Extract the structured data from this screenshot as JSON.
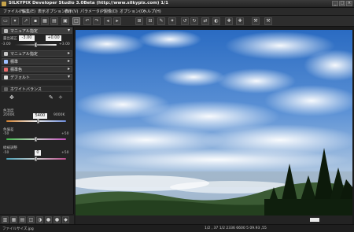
{
  "window": {
    "title": "SILKYPIX Developer Studio 3.0Beta (http://www.silkypix.com)   1/1",
    "controls": [
      "_",
      "□",
      "×"
    ]
  },
  "menu": [
    "ファイル(F)",
    "編集(E)",
    "表示オプション(V)",
    "表示(V)",
    "パラメータ(P)",
    "現像(D)",
    "オプション(O)",
    "ヘルプ(H)"
  ],
  "left_panel": {
    "exposure": {
      "label": "露出補正",
      "value": "-3.00",
      "value2": "+0.00",
      "min": "-3.00",
      "max": "+3.00"
    },
    "rows": [
      {
        "label": "マニュアル指定"
      },
      {
        "label": "マニュアル指定"
      },
      {
        "label": "標準"
      },
      {
        "label": "標準色"
      },
      {
        "label": "デフォルト"
      }
    ],
    "wb_header": "ホワイトバランス",
    "color_temp": {
      "label": "色温度",
      "value": "5400",
      "min": "2000K",
      "max": "9000K"
    },
    "color_bias": {
      "label": "色偏差",
      "min": "-50",
      "max": "+50",
      "value": "0"
    },
    "green_mag": {
      "label": "緑被調整",
      "min": "-50",
      "max": "+50",
      "value": "0"
    }
  },
  "status": {
    "left": "ファイルサイズ.jpg",
    "right": "1/2 , 37  1/2 2336 6600  5 09.93 ,55",
    "zoom": "37"
  }
}
